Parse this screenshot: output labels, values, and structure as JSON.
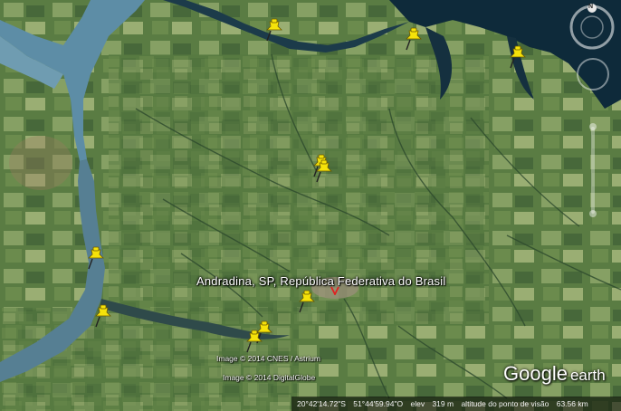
{
  "map": {
    "place_label": "Andradina, SP, República Federativa do Brasil",
    "credits": [
      "Image © 2014 CNES / Astrium",
      "Image © 2014 DigitalGlobe"
    ],
    "logo_text": "Google",
    "logo_suffix": "earth",
    "compass_letter": "N",
    "pin_count": 10,
    "pin_color": "#f5e20a"
  },
  "status": {
    "latitude": "20°42'14.72\"S",
    "longitude": "51°44'59.94\"O",
    "elevation_label": "elev",
    "elevation": "319 m",
    "eye_alt_label": "altitude do ponto de visão",
    "eye_alt": "63.56 km"
  },
  "colors": {
    "water": "#5d8da6",
    "dark_water": "#0e2a3a",
    "vegetation": "#4f7342"
  }
}
